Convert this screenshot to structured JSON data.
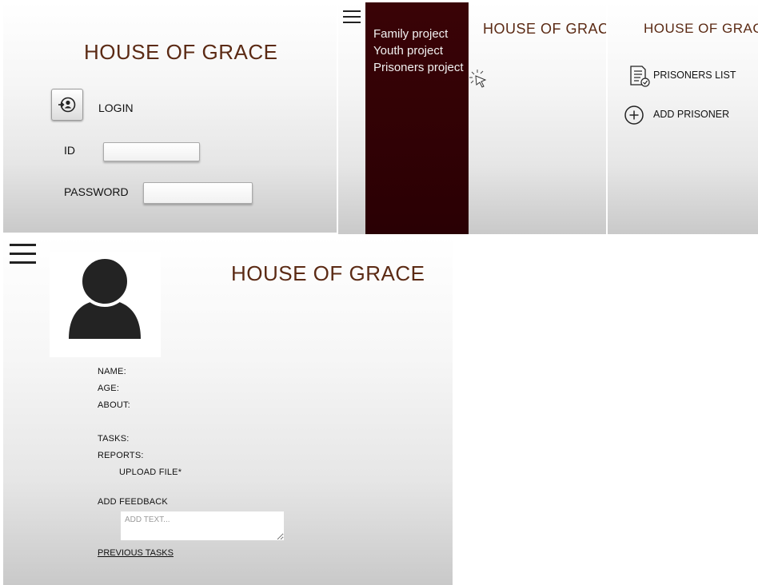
{
  "login_screen": {
    "brand": "HOUSE OF GRACE",
    "login_label": "LOGIN",
    "id_label": "ID",
    "id_value": "",
    "password_label": "PASSWORD",
    "password_value": ""
  },
  "menu_screen": {
    "brand": "HOUSE OF GRACE",
    "menu_items": [
      "Family project",
      "Youth project",
      "Prisoners project"
    ]
  },
  "prisoners_screen": {
    "brand": "HOUSE OF GRACE",
    "list_label": "PRISONERS LIST",
    "add_label": "ADD PRISONER"
  },
  "profile_screen": {
    "brand": "HOUSE OF GRACE",
    "name_label": "NAME:",
    "age_label": "AGE:",
    "about_label": "ABOUT:",
    "tasks_label": "TASKS:",
    "reports_label": "REPORTS:",
    "upload_label": "UPLOAD FILE*",
    "feedback_label": "ADD FEEDBACK",
    "feedback_placeholder": "ADD TEXT...",
    "previous_tasks_link": "PREVIOUS TASKS"
  },
  "colors": {
    "brand": "#5b2a14",
    "menu_background": "#2f0205",
    "menu_text": "#f1f1f1"
  },
  "icons": [
    "login-person-icon",
    "hamburger-menu-icon",
    "pointer-click-icon",
    "checklist-icon",
    "plus-circle-icon",
    "user-avatar-icon"
  ]
}
